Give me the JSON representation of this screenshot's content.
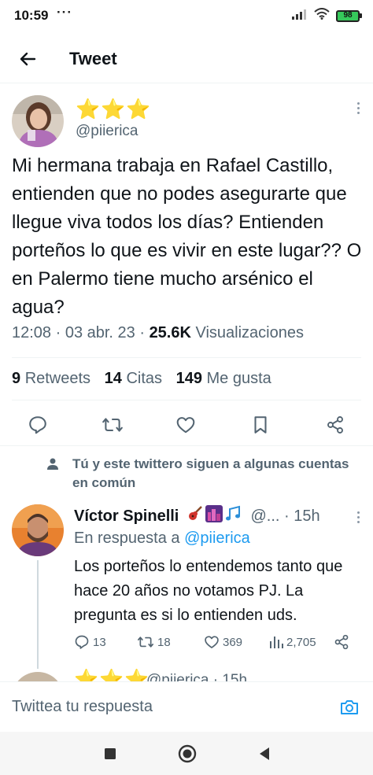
{
  "status_bar": {
    "time": "10:59",
    "dots": "···",
    "battery": "98"
  },
  "header": {
    "title": "Tweet"
  },
  "tweet": {
    "stars": "⭐⭐⭐",
    "handle": "@piierica",
    "text": "Mi hermana trabaja en Rafael Castillo, entienden que no podes asegurarte que llegue viva todos los días? Entienden porteños lo que es vivir en este lugar?? O en Palermo tiene mucho arsénico el agua?",
    "time_date": "12:08 · 03 abr. 23 · ",
    "views_count": "25.6K",
    "views_label": " Visualizaciones"
  },
  "stats": {
    "retweets_count": "9",
    "retweets_label": "Retweets",
    "quotes_count": "14",
    "quotes_label": "Citas",
    "likes_count": "149",
    "likes_label": "Me gusta"
  },
  "social_context": {
    "text": "Tú y este twittero siguen a algunas cuentas en común"
  },
  "reply": {
    "name": "Víctor Spinelli",
    "handle_time": "@... · 15h",
    "replying_prefix": "En respuesta a ",
    "replying_to": "@piierica",
    "text": "Los porteños lo entendemos tanto que hace 20 años no votamos PJ. La pregunta es si lo entienden uds.",
    "replies": "13",
    "retweets": "18",
    "likes": "369",
    "views": "2,705"
  },
  "next_reply": {
    "stars": "⭐⭐⭐",
    "handle_time": "@piierica · 15h"
  },
  "composer": {
    "placeholder": "Twittea tu respuesta"
  },
  "colors": {
    "accent": "#1d9bf0",
    "secondary_text": "#536471",
    "primary_text": "#0f1419",
    "star": "#f5c518"
  }
}
